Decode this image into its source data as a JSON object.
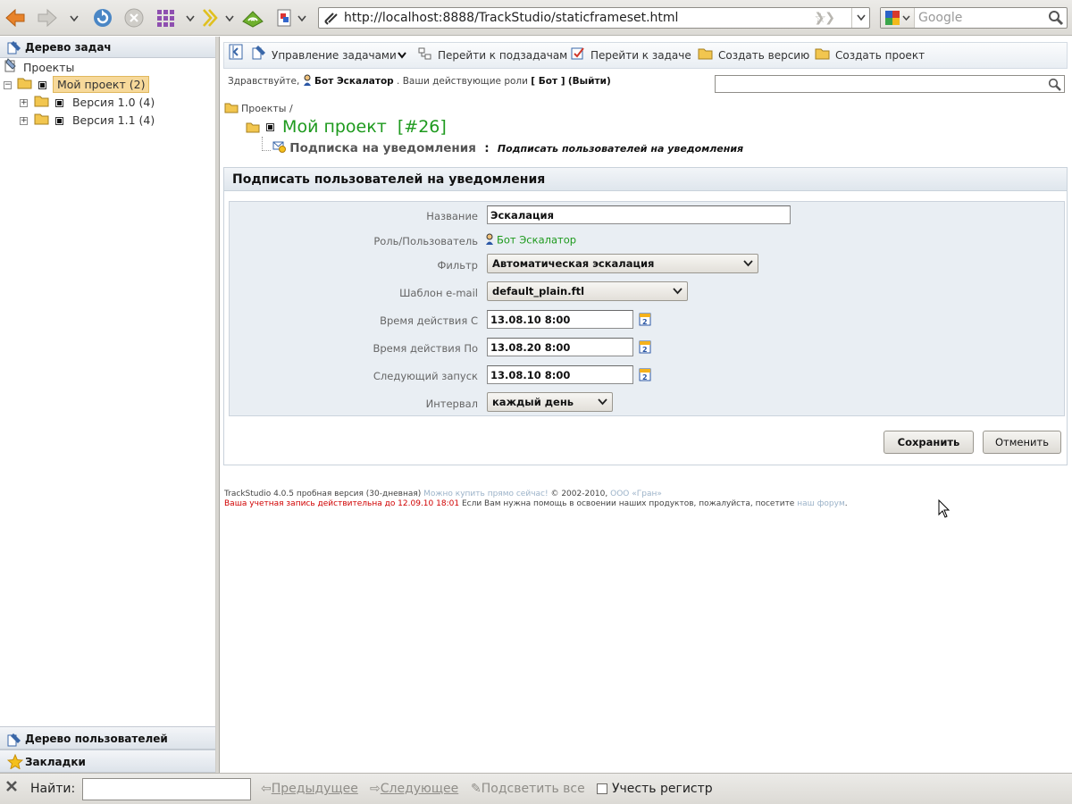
{
  "browser": {
    "url": "http://localhost:8888/TrackStudio/staticframeset.html",
    "search_placeholder": "Google"
  },
  "left": {
    "tree_header": "Дерево задач",
    "tree": [
      {
        "label": "Проекты",
        "level": 0,
        "type": "root"
      },
      {
        "label": "Мой проект (2)",
        "level": 1,
        "type": "project",
        "selected": true
      },
      {
        "label": "Версия 1.0 (4)",
        "level": 2,
        "type": "version"
      },
      {
        "label": "Версия 1.1 (4)",
        "level": 2,
        "type": "version"
      }
    ],
    "users_header": "Дерево пользователей",
    "bookmarks_header": "Закладки"
  },
  "actions": {
    "manage": "Управление задачами",
    "subtasks": "Перейти к подзадачам",
    "goto_task": "Перейти к задаче",
    "create_version": "Создать версию",
    "create_project": "Создать проект"
  },
  "greeting": {
    "hello": "Здравствуйте,",
    "user": "Бот Эскалатор",
    "roles_prefix": ". Ваши действующие роли",
    "roles": "[ Бот ]",
    "logout": "(Выйти)"
  },
  "breadcrumb": {
    "root": "Проекты",
    "sep": "/"
  },
  "task": {
    "title": "Мой проект",
    "number": "[#26]",
    "sub_name": "Подписка на уведомления",
    "sub_sep": ":",
    "sub_desc": "Подписать пользователей на уведомления"
  },
  "form": {
    "heading": "Подписать пользователей на уведомления",
    "fields": {
      "name_label": "Название",
      "name_value": "Эскалация",
      "role_label": "Роль/Пользователь",
      "role_value": "Бот Эскалатор",
      "filter_label": "Фильтр",
      "filter_value": "Автоматическая эскалация",
      "template_label": "Шаблон e-mail",
      "template_value": "default_plain.ftl",
      "from_label": "Время действия С",
      "from_value": "13.08.10 8:00",
      "to_label": "Время действия По",
      "to_value": "13.08.20 8:00",
      "next_label": "Следующий запуск",
      "next_value": "13.08.10 8:00",
      "interval_label": "Интервал",
      "interval_value": "каждый день"
    },
    "save": "Сохранить",
    "cancel": "Отменить"
  },
  "footer": {
    "line1_a": "TrackStudio 4.0.5 пробная версия (30-дневная)",
    "line1_link": "Можно купить прямо сейчас!",
    "line1_b": "© 2002-2010,",
    "line1_company": "ООО «Гран»",
    "line2_red": "Ваша учетная запись действительна до 12.09.10 18:01",
    "line2_b": "Если Вам нужна помощь в освоении наших продуктов, пожалуйста, посетите",
    "line2_link": "наш форум",
    "line2_end": "."
  },
  "findbar": {
    "label": "Найти:",
    "prev": "Предыдущее",
    "next": "Следующее",
    "highlight": "Подсветить все",
    "match_case": "Учесть регистр"
  }
}
